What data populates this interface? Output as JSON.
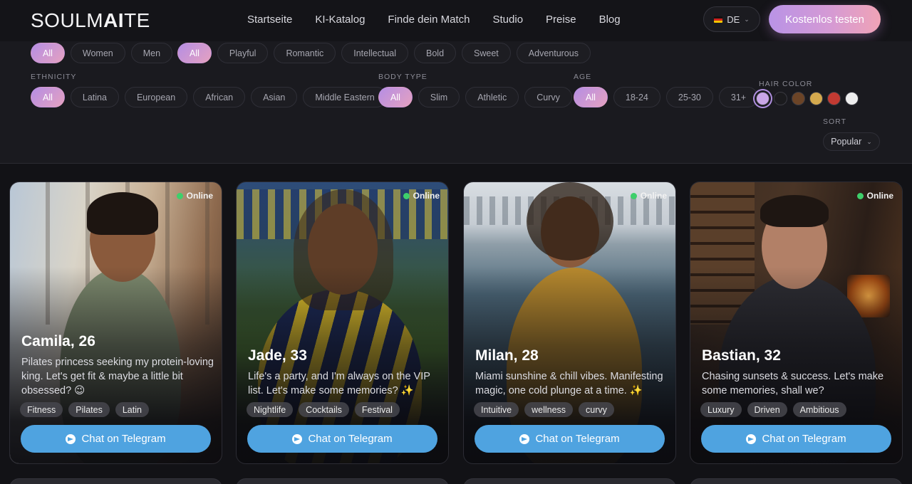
{
  "header": {
    "logo_pre": "SOULM",
    "logo_bold": "AI",
    "logo_post": "TE",
    "nav": [
      "Startseite",
      "KI-Katalog",
      "Finde dein Match",
      "Studio",
      "Preise",
      "Blog"
    ],
    "language": "DE",
    "cta": "Kostenlos testen"
  },
  "filters": {
    "gender": [
      "All",
      "Women",
      "Men"
    ],
    "personality": [
      "All",
      "Playful",
      "Romantic",
      "Intellectual",
      "Bold",
      "Sweet",
      "Adventurous"
    ],
    "ethnicity_label": "ETHNICITY",
    "ethnicity": [
      "All",
      "Latina",
      "European",
      "African",
      "Asian",
      "Middle Eastern"
    ],
    "body_label": "BODY TYPE",
    "body": [
      "All",
      "Slim",
      "Athletic",
      "Curvy"
    ],
    "age_label": "AGE",
    "age": [
      "All",
      "18-24",
      "25-30",
      "31+"
    ],
    "hair_label": "HAIR COLOR",
    "hair_colors": [
      "#c9a6e6",
      "#1b1b1e",
      "#6b4427",
      "#d4a94e",
      "#c23a32",
      "#eeeeee"
    ],
    "sort_label": "SORT",
    "sort_value": "Popular"
  },
  "cards": [
    {
      "name": "Camila, 26",
      "status": "Online",
      "bio": "Pilates princess seeking my protein-loving king. Let's get fit & maybe a little bit obsessed? 😉",
      "tags": [
        "Fitness",
        "Pilates",
        "Latin"
      ],
      "cta": "Chat on  Telegram"
    },
    {
      "name": "Jade, 33",
      "status": "Online",
      "bio": "Life's a party, and I'm always on the VIP list. Let's make some memories? ✨",
      "tags": [
        "Nightlife",
        "Cocktails",
        "Festival"
      ],
      "cta": "Chat on  Telegram"
    },
    {
      "name": "Milan, 28",
      "status": "Online",
      "bio": "Miami sunshine & chill vibes. Manifesting magic, one cold plunge at a time. ✨",
      "tags": [
        "Intuitive",
        "wellness",
        "curvy"
      ],
      "cta": "Chat on  Telegram"
    },
    {
      "name": "Bastian, 32",
      "status": "Online",
      "bio": "Chasing sunsets & success. Let's make some memories, shall we?",
      "tags": [
        "Luxury",
        "Driven",
        "Ambitious"
      ],
      "cta": "Chat on  Telegram"
    }
  ]
}
